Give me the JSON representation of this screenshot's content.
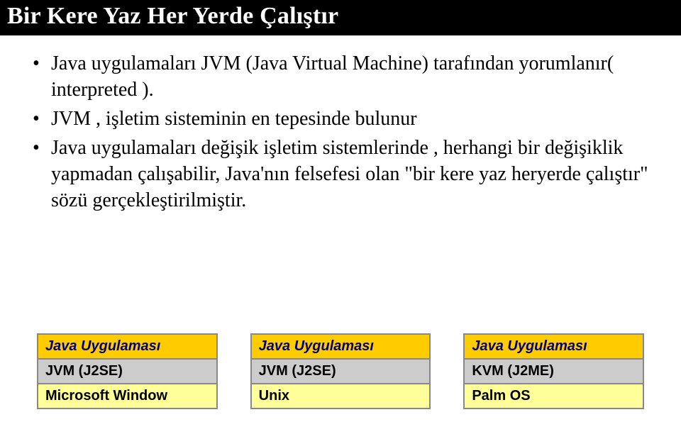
{
  "title": "Bir Kere Yaz Her Yerde Çalıştır",
  "bullets": [
    "Java uygulamaları JVM (Java Virtual Machine) tarafından yorumlanır( interpreted ).",
    "JVM , işletim sisteminin en tepesinde bulunur",
    "Java uygulamaları değişik işletim sistemlerinde , herhangi bir değişiklik yapmadan çalışabilir, Java'nın felsefesi olan \"bir kere yaz heryerde çalıştır\" sözü gerçekleştirilmiştir."
  ],
  "tables": [
    {
      "app": "Java Uygulaması",
      "vm": "JVM (J2SE)",
      "os": "Microsoft Window"
    },
    {
      "app": "Java Uygulaması",
      "vm": "JVM (J2SE)",
      "os": "Unix"
    },
    {
      "app": "Java Uygulaması",
      "vm": "KVM (J2ME)",
      "os": "Palm OS"
    }
  ]
}
